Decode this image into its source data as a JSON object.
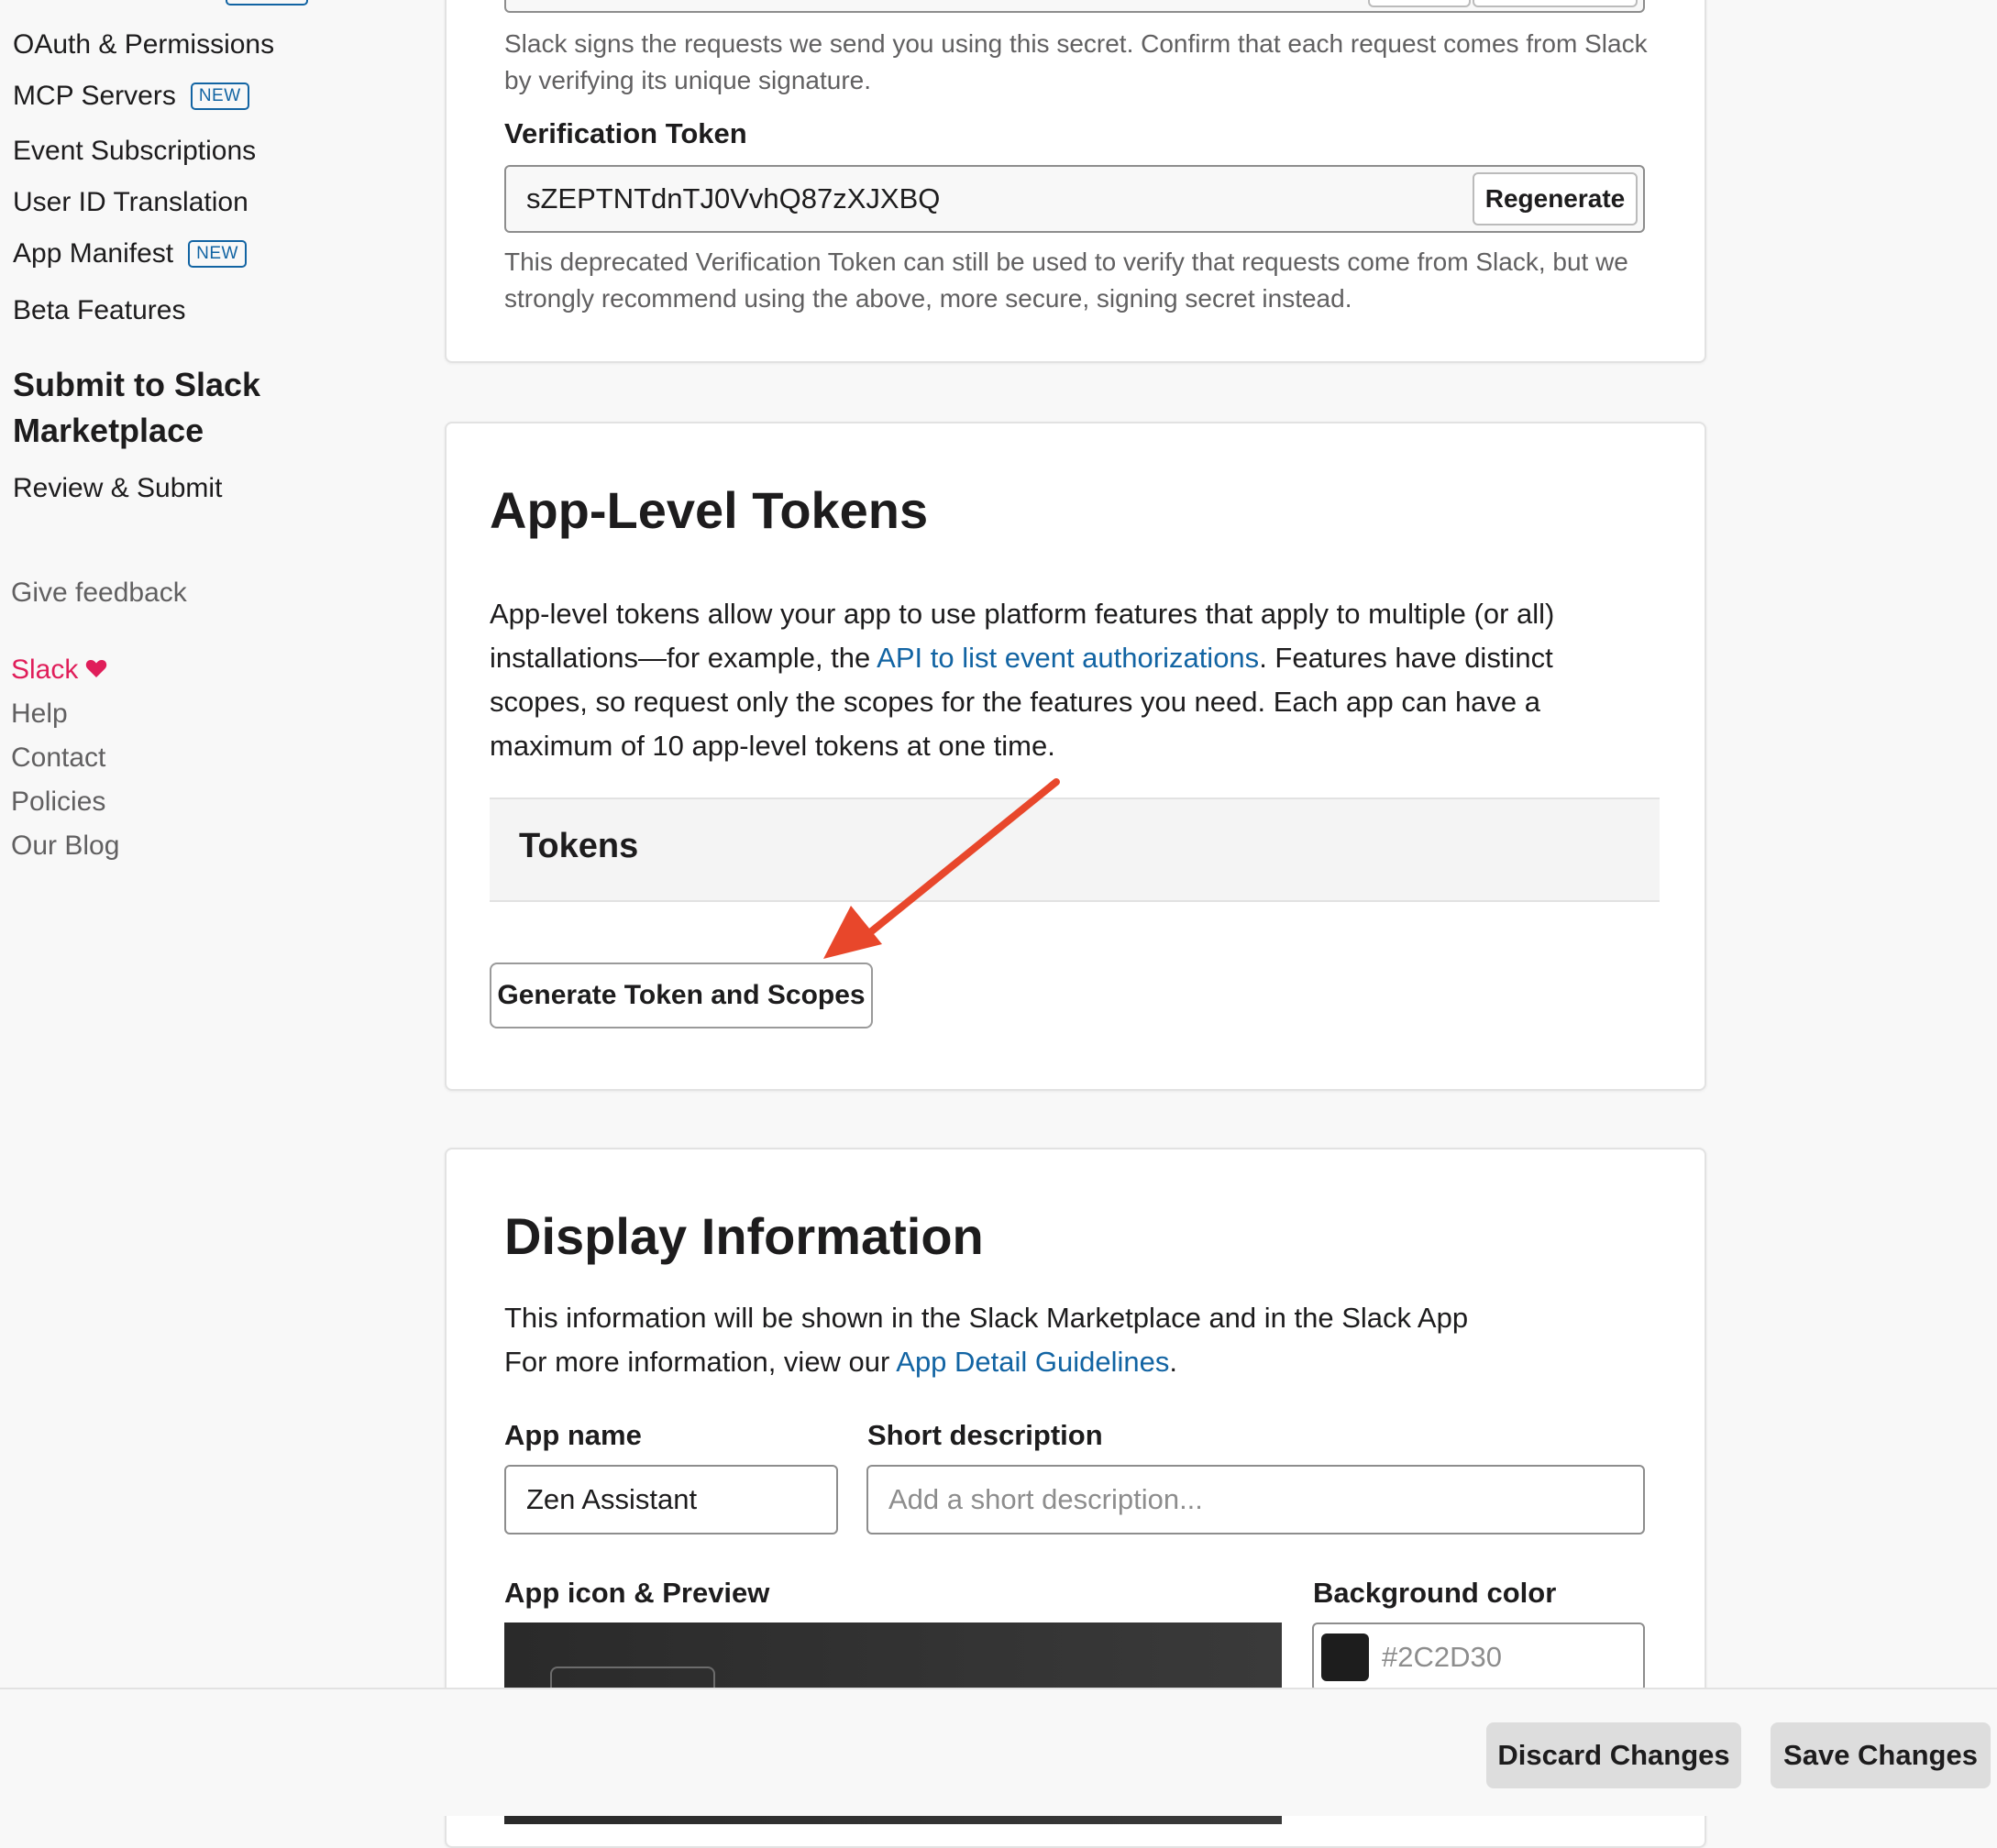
{
  "sidebar": {
    "items": [
      {
        "label": "OAuth & Permissions"
      },
      {
        "label": "MCP Servers",
        "badge": "NEW"
      },
      {
        "label": "Event Subscriptions"
      },
      {
        "label": "User ID Translation"
      },
      {
        "label": "App Manifest",
        "badge": "NEW"
      },
      {
        "label": "Beta Features"
      }
    ],
    "section_heading": "Submit to Slack Marketplace",
    "review_submit": "Review & Submit",
    "give_feedback": "Give feedback",
    "slack_label": "Slack",
    "footer_links": [
      "Help",
      "Contact",
      "Policies",
      "Our Blog"
    ]
  },
  "credentials": {
    "signing_secret_help": "Slack signs the requests we send you using this secret. Confirm that each request comes from Slack by verifying its unique signature.",
    "verification_token_label": "Verification Token",
    "verification_token_value": "sZEPTNTdnTJ0VvhQ87zXJXBQ",
    "regenerate_label": "Regenerate",
    "verification_token_help": "This deprecated Verification Token can still be used to verify that requests come from Slack, but we strongly recommend using the above, more secure, signing secret instead."
  },
  "app_level_tokens": {
    "title": "App-Level Tokens",
    "description_before_link": "App-level tokens allow your app to use platform features that apply to multiple (or all) installations—for example, the ",
    "link_text": "API to list event authorizations",
    "description_after_link": ". Features have distinct scopes, so request only the scopes for the features you need. Each app can have a maximum of 10 app-level tokens at one time.",
    "tokens_header": "Tokens",
    "generate_button": "Generate Token and Scopes"
  },
  "display_information": {
    "title": "Display Information",
    "line1": "This information will be shown in the Slack Marketplace and in the Slack App",
    "line2_before_link": "For more information, view our ",
    "line2_link": "App Detail Guidelines",
    "line2_after_link": ".",
    "app_name_label": "App name",
    "app_name_value": "Zen Assistant",
    "short_desc_label": "Short description",
    "short_desc_placeholder": "Add a short description...",
    "app_icon_label": "App icon & Preview",
    "bg_color_label": "Background color",
    "bg_color_value": "#2C2D30"
  },
  "footer": {
    "discard_label": "Discard Changes",
    "save_label": "Save Changes"
  },
  "colors": {
    "link": "#1264a3",
    "slack_pink": "#e01e5a",
    "annotation_arrow": "#e8472b",
    "swatch": "#1d1d1d"
  },
  "icons": {
    "heart": "heart-icon",
    "annotation": "annotation-arrow-icon"
  }
}
